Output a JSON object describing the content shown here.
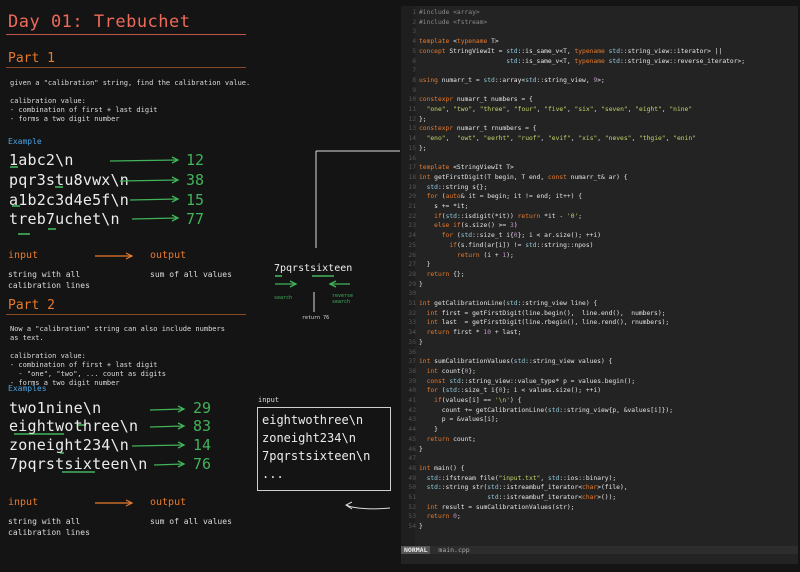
{
  "title": "Day 01: Trebuchet",
  "part1": {
    "heading": "Part 1",
    "desc": "given a \"calibration\" string, find the calibration value.\n\ncalibration value:\n- combination of first + last digit\n- forms a two digit number",
    "example_label": "Example",
    "examples": [
      {
        "input": "1abc2\\n",
        "output": "12"
      },
      {
        "input": "pqr3stu8vwx\\n",
        "output": "38"
      },
      {
        "input": "a1b2c3d4e5f\\n",
        "output": "15"
      },
      {
        "input": "treb7uchet\\n",
        "output": "77"
      }
    ],
    "io_input": "input",
    "io_output": "output",
    "io_input_desc": "string with all\ncalibration lines",
    "io_output_desc": "sum of all values"
  },
  "part2": {
    "heading": "Part 2",
    "desc": "Now a \"calibration\" string can also include numbers\nas text.\n\ncalibration value:\n- combination of first + last digit\n  - \"one\", \"two\", ... count as digits\n- forms a two digit number",
    "example_label": "Examples",
    "examples": [
      {
        "input": "two1nine\\n",
        "output": "29"
      },
      {
        "input": "eightwothree\\n",
        "output": "83"
      },
      {
        "input": "zoneight234\\n",
        "output": "14"
      },
      {
        "input": "7pqrstsixteen\\n",
        "output": "76"
      }
    ],
    "io_input": "input",
    "io_output": "output",
    "io_input_desc": "string with all\ncalibration lines",
    "io_output_desc": "sum of all values"
  },
  "diagram": {
    "word": "7pqrstsixteen",
    "left_label": "search",
    "right_label": "reverse\nsearch",
    "bottom_label": "return 76"
  },
  "input_box": {
    "label": "input",
    "lines": [
      "eightwothree\\n",
      "zoneight234\\n",
      "7pqrstsixteen\\n",
      "..."
    ]
  },
  "editor": {
    "mode": "NORMAL",
    "filename": "main.cpp",
    "lines": [
      "#include <array>",
      "#include <fstream>",
      "",
      "template <typename T>",
      "concept StringViewIt = std::is_same_v<T, typename std::string_view::iterator> ||",
      "                       std::is_same_v<T, typename std::string_view::reverse_iterator>;",
      "",
      "using numarr_t = std::array<std::string_view, 9>;",
      "",
      "constexpr numarr_t numbers = {",
      "  \"one\", \"two\", \"three\", \"four\", \"five\", \"six\", \"seven\", \"eight\", \"nine\"",
      "};",
      "constexpr numarr_t rnumbers = {",
      "  \"eno\",  \"owt\", \"eerht\", \"ruof\", \"evif\", \"xis\", \"neves\", \"thgie\", \"enin\"",
      "};",
      "",
      "template <StringViewIt T>",
      "int getFirstDigit(T begin, T end, const numarr_t& ar) {",
      "  std::string s{};",
      "  for (auto& it = begin; it != end; it++) {",
      "    s += *it;",
      "    if(std::isdigit(*it)) return *it - '0';",
      "    else if(s.size() >= 3)",
      "      for (std::size_t i{0}; i < ar.size(); ++i)",
      "        if(s.find(ar[i]) != std::string::npos)",
      "          return (i + 1);",
      "  }",
      "  return {};",
      "}",
      "",
      "int getCalibrationLine(std::string_view line) {",
      "  int first = getFirstDigit(line.begin(),  line.end(),  numbers);",
      "  int last  = getFirstDigit(line.rbegin(), line.rend(), rnumbers);",
      "  return first * 10 + last;",
      "}",
      "",
      "int sumCalibrationValues(std::string_view values) {",
      "  int count{0};",
      "  const std::string_view::value_type* p = values.begin();",
      "  for (std::size_t i{0}; i < values.size(); ++i)",
      "    if(values[i] == '\\n') {",
      "      count += getCalibrationLine(std::string_view{p, &values[i]});",
      "      p = &values[i];",
      "    }",
      "  return count;",
      "}",
      "",
      "int main() {",
      "  std::ifstream file(\"input.txt\", std::ios::binary);",
      "  std::string str(std::istreambuf_iterator<char>(file),",
      "                  std::istreambuf_iterator<char>());",
      "  int result = sumCalibrationValues(str);",
      "  return 0;",
      "}"
    ]
  },
  "colors": {
    "title": "#ef6a5a",
    "section": "#e77a2c",
    "example_label": "#4aa3e0",
    "result_green": "#41b35a",
    "keyword": "#e77a2c",
    "string": "#c7d36a"
  }
}
